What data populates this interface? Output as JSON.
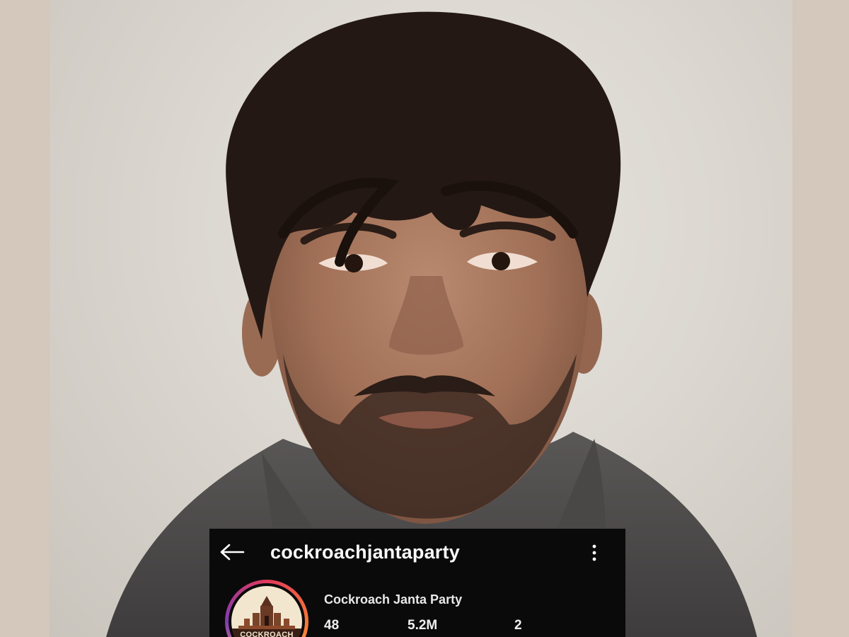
{
  "profile": {
    "username": "cockroachjantaparty",
    "display_name": "Cockroach Janta Party",
    "stats": {
      "posts": "48",
      "followers": "5.2M",
      "following": "2"
    },
    "avatar_text": "COCKROACH"
  },
  "icons": {
    "back": "arrow-left-icon",
    "more": "more-vertical-icon"
  },
  "colors": {
    "page_border": "#d4c7bb",
    "card_background": "#0a0a0a",
    "text": "#ffffff"
  }
}
